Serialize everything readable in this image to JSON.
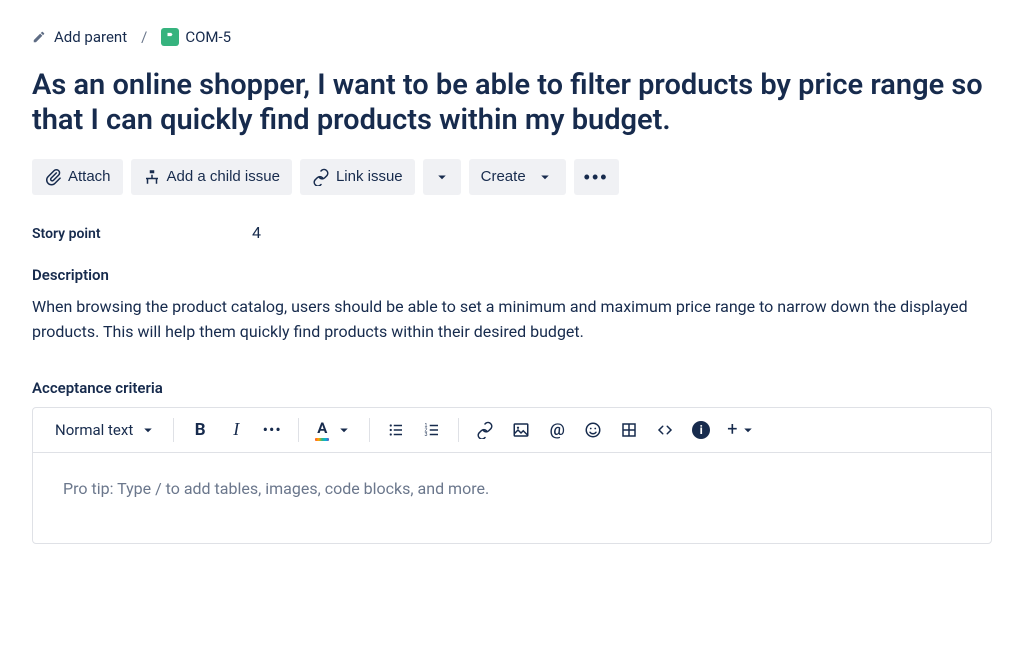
{
  "breadcrumb": {
    "add_parent": "Add parent",
    "issue_key": "COM-5"
  },
  "title": "As an online shopper, I want to be able to filter products by price range so that I can quickly find products within my budget.",
  "actions": {
    "attach": "Attach",
    "add_child": "Add a child issue",
    "link_issue": "Link issue",
    "create": "Create"
  },
  "fields": {
    "story_point_label": "Story point",
    "story_point_value": "4"
  },
  "description": {
    "heading": "Description",
    "text": "When browsing the product catalog, users should be able to set a minimum and maximum price range to narrow down the displayed products. This will help them quickly find products within their desired budget."
  },
  "acceptance": {
    "heading": "Acceptance criteria"
  },
  "editor": {
    "text_style": "Normal text",
    "placeholder": "Pro tip: Type / to add tables, images, code blocks, and more."
  }
}
